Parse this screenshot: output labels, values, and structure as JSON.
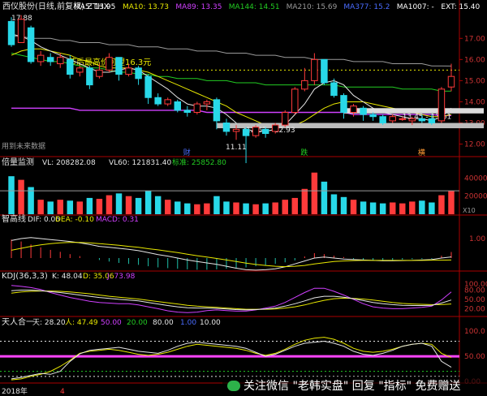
{
  "colors": {
    "up": "#ff3b3b",
    "down": "#28d8e8",
    "yellow": "#e8e800",
    "white": "#e6e6e6",
    "purple": "#d040ff",
    "green": "#22cc22",
    "grey": "#9a9a9a",
    "axis": "#aa0000",
    "magenta": "#ff44ff"
  },
  "main": {
    "title": "西仪股份(日线,前复权) ZTHX",
    "legend": [
      {
        "label": "MA5: 13.95",
        "color": "#ffffff"
      },
      {
        "label": "MA10: 13.73",
        "color": "#e8e800"
      },
      {
        "label": "MA89: 13.35",
        "color": "#d040ff"
      },
      {
        "label": "MA144: 14.51",
        "color": "#22cc22"
      },
      {
        "label": "MA210: 15.69",
        "color": "#9a9a9a"
      },
      {
        "label": "MA377: 15.2",
        "color": "#4a6cff"
      },
      {
        "label": "MA1007: -",
        "color": "#ffffff"
      },
      {
        "label": "EXT: 15.40",
        "color": "#ffffff"
      }
    ],
    "high_label": "17.88",
    "low_label": "11.11",
    "note": "用到未来数据",
    "annot_mid": "节后最高价可望",
    "annot_price": "16.3元",
    "box1": "13.45 - 13.61",
    "box2": "12.67 - 12.93",
    "tags": [
      "财",
      "跌",
      "横"
    ],
    "yaxis": [
      "17.00",
      "16.00",
      "15.00",
      "14.00",
      "13.00",
      "12.00"
    ]
  },
  "volume": {
    "title": "倍量监测",
    "vl": "VL: 208282.08",
    "vl60": "VL60: 121831.40",
    "std": "标准: 25852.80",
    "yaxis": [
      "40000",
      "20000"
    ],
    "unit": "X10"
  },
  "macd": {
    "title": "智高线",
    "dif": "DIF: 0.06",
    "dea": "DEA: -0.10",
    "macd": "MACD: 0.31",
    "yaxis": [
      "1.00"
    ]
  },
  "kdj": {
    "title": "KDJ(36,3,3)",
    "k": "K: 48.04",
    "d": "D: 35.06",
    "j": "J: 73.98",
    "yaxis": [
      "100.00",
      "80.00",
      "50.00",
      "20.00"
    ]
  },
  "tianren": {
    "title": "天人合一",
    "tian": "天: 28.20",
    "ren": "人: 47.49",
    "v50": "50.00",
    "v20": "20.00",
    "v80": "80.00",
    "v_blue": "1.00",
    "v10": "10.00",
    "yaxis": [
      "100.0",
      "50.00",
      "0.00"
    ]
  },
  "footer": {
    "year": "2018年",
    "mark": "4"
  },
  "watermark": "关注微信 \"老韩实盘\" 回复 \"指标\" 免费赠送",
  "chart_data": {
    "type": "candlestick",
    "candles": [
      {
        "o": 17.8,
        "c": 16.7,
        "h": 18.0,
        "l": 16.6
      },
      {
        "o": 16.8,
        "c": 17.9,
        "h": 18.1,
        "l": 16.8
      },
      {
        "o": 17.5,
        "c": 15.9,
        "h": 17.6,
        "l": 15.8
      },
      {
        "o": 15.9,
        "c": 16.2,
        "h": 16.4,
        "l": 15.7
      },
      {
        "o": 16.1,
        "c": 15.9,
        "h": 16.3,
        "l": 15.7
      },
      {
        "o": 15.8,
        "c": 16.1,
        "h": 16.3,
        "l": 15.6
      },
      {
        "o": 16.0,
        "c": 15.3,
        "h": 16.2,
        "l": 15.1
      },
      {
        "o": 15.4,
        "c": 15.6,
        "h": 15.7,
        "l": 15.2
      },
      {
        "o": 15.6,
        "c": 14.8,
        "h": 15.7,
        "l": 14.6
      },
      {
        "o": 15.2,
        "c": 15.5,
        "h": 15.8,
        "l": 15.1
      },
      {
        "o": 15.5,
        "c": 16.1,
        "h": 16.3,
        "l": 15.4
      },
      {
        "o": 16.1,
        "c": 15.3,
        "h": 16.1,
        "l": 15.0
      },
      {
        "o": 15.3,
        "c": 15.6,
        "h": 15.8,
        "l": 15.2
      },
      {
        "o": 15.6,
        "c": 15.1,
        "h": 15.7,
        "l": 14.8
      },
      {
        "o": 15.2,
        "c": 14.2,
        "h": 15.3,
        "l": 13.9
      },
      {
        "o": 14.2,
        "c": 13.9,
        "h": 14.4,
        "l": 13.8
      },
      {
        "o": 13.9,
        "c": 14.1,
        "h": 14.2,
        "l": 13.8
      },
      {
        "o": 14.0,
        "c": 13.6,
        "h": 14.1,
        "l": 13.5
      },
      {
        "o": 13.6,
        "c": 13.5,
        "h": 13.8,
        "l": 13.3
      },
      {
        "o": 13.5,
        "c": 13.9,
        "h": 14.0,
        "l": 13.4
      },
      {
        "o": 13.9,
        "c": 14.0,
        "h": 14.1,
        "l": 13.6
      },
      {
        "o": 14.1,
        "c": 13.1,
        "h": 14.2,
        "l": 12.7
      },
      {
        "o": 13.0,
        "c": 12.6,
        "h": 13.2,
        "l": 12.4
      },
      {
        "o": 12.6,
        "c": 12.7,
        "h": 12.9,
        "l": 12.2
      },
      {
        "o": 12.7,
        "c": 12.4,
        "h": 12.8,
        "l": 11.1
      },
      {
        "o": 12.4,
        "c": 12.8,
        "h": 12.9,
        "l": 12.3
      },
      {
        "o": 12.7,
        "c": 12.5,
        "h": 12.8,
        "l": 12.3
      },
      {
        "o": 12.6,
        "c": 12.9,
        "h": 13.0,
        "l": 12.5
      },
      {
        "o": 12.9,
        "c": 13.5,
        "h": 13.6,
        "l": 12.8
      },
      {
        "o": 13.5,
        "c": 14.6,
        "h": 14.7,
        "l": 13.4
      },
      {
        "o": 14.6,
        "c": 15.0,
        "h": 15.6,
        "l": 14.5
      },
      {
        "o": 15.0,
        "c": 16.0,
        "h": 16.3,
        "l": 14.8
      },
      {
        "o": 16.0,
        "c": 14.9,
        "h": 16.0,
        "l": 14.8
      },
      {
        "o": 14.9,
        "c": 14.3,
        "h": 15.1,
        "l": 14.2
      },
      {
        "o": 14.3,
        "c": 13.5,
        "h": 14.4,
        "l": 13.2
      },
      {
        "o": 13.5,
        "c": 13.8,
        "h": 13.9,
        "l": 13.3
      },
      {
        "o": 13.7,
        "c": 13.4,
        "h": 13.8,
        "l": 13.1
      },
      {
        "o": 13.4,
        "c": 13.3,
        "h": 13.5,
        "l": 13.1
      },
      {
        "o": 13.3,
        "c": 13.0,
        "h": 13.4,
        "l": 12.9
      },
      {
        "o": 13.1,
        "c": 13.3,
        "h": 13.4,
        "l": 13.0
      },
      {
        "o": 13.2,
        "c": 13.2,
        "h": 13.3,
        "l": 13.1
      },
      {
        "o": 13.1,
        "c": 13.2,
        "h": 13.3,
        "l": 12.9
      },
      {
        "o": 13.2,
        "c": 13.1,
        "h": 13.4,
        "l": 13.0
      },
      {
        "o": 13.2,
        "c": 13.0,
        "h": 13.4,
        "l": 12.9
      },
      {
        "o": 13.1,
        "c": 14.6,
        "h": 14.7,
        "l": 13.0
      },
      {
        "o": 14.7,
        "c": 15.2,
        "h": 15.8,
        "l": 14.5
      }
    ],
    "ma5": [
      17.2,
      17.1,
      16.9,
      16.6,
      16.4,
      16.2,
      16.0,
      15.8,
      15.6,
      15.4,
      15.4,
      15.5,
      15.6,
      15.5,
      15.2,
      14.9,
      14.6,
      14.2,
      13.9,
      13.8,
      13.8,
      13.7,
      13.4,
      13.0,
      12.7,
      12.6,
      12.6,
      12.7,
      12.9,
      13.4,
      13.9,
      14.6,
      14.9,
      15.0,
      14.8,
      14.3,
      14.0,
      13.7,
      13.5,
      13.4,
      13.3,
      13.2,
      13.2,
      13.1,
      13.3,
      13.7
    ],
    "ma10": [
      16.2,
      16.4,
      16.5,
      16.5,
      16.4,
      16.3,
      16.2,
      16.0,
      15.9,
      15.7,
      15.6,
      15.6,
      15.6,
      15.5,
      15.4,
      15.2,
      15.0,
      14.8,
      14.6,
      14.4,
      14.2,
      14.0,
      13.8,
      13.5,
      13.3,
      13.1,
      12.9,
      12.8,
      12.8,
      12.9,
      13.1,
      13.4,
      13.7,
      13.9,
      14.0,
      14.0,
      14.0,
      13.9,
      13.8,
      13.7,
      13.6,
      13.5,
      13.4,
      13.3,
      13.3,
      13.4
    ],
    "ma89": [
      13.7,
      13.7,
      13.7,
      13.7,
      13.7,
      13.7,
      13.7,
      13.6,
      13.6,
      13.6,
      13.6,
      13.6,
      13.6,
      13.6,
      13.6,
      13.6,
      13.6,
      13.6,
      13.6,
      13.6,
      13.5,
      13.5,
      13.5,
      13.5,
      13.5,
      13.5,
      13.5,
      13.5,
      13.5,
      13.5,
      13.5,
      13.5,
      13.5,
      13.5,
      13.5,
      13.4,
      13.4,
      13.4,
      13.4,
      13.4,
      13.4,
      13.4,
      13.4,
      13.4,
      13.35,
      13.35
    ],
    "ma144": [
      16.3,
      16.2,
      16.1,
      16.0,
      15.9,
      15.9,
      15.8,
      15.7,
      15.6,
      15.6,
      15.5,
      15.4,
      15.4,
      15.3,
      15.3,
      15.2,
      15.2,
      15.1,
      15.1,
      15.1,
      15.0,
      15.0,
      15.0,
      14.9,
      14.9,
      14.9,
      14.8,
      14.8,
      14.8,
      14.8,
      14.8,
      14.8,
      14.8,
      14.8,
      14.7,
      14.7,
      14.7,
      14.7,
      14.7,
      14.7,
      14.6,
      14.6,
      14.6,
      14.6,
      14.5,
      14.51
    ],
    "ma210": [
      17.1,
      17.1,
      17.0,
      17.0,
      17.0,
      16.9,
      16.9,
      16.8,
      16.8,
      16.8,
      16.7,
      16.7,
      16.7,
      16.6,
      16.6,
      16.6,
      16.5,
      16.5,
      16.5,
      16.4,
      16.4,
      16.4,
      16.3,
      16.3,
      16.3,
      16.2,
      16.2,
      16.2,
      16.1,
      16.1,
      16.1,
      16.0,
      16.0,
      16.0,
      16.0,
      15.9,
      15.9,
      15.9,
      15.9,
      15.8,
      15.8,
      15.8,
      15.8,
      15.7,
      15.7,
      15.69
    ],
    "volume": [
      42000,
      38000,
      30000,
      16000,
      14000,
      16000,
      15000,
      14000,
      18000,
      17000,
      21000,
      23000,
      20000,
      18000,
      26000,
      20000,
      16000,
      14000,
      12000,
      11000,
      12000,
      20000,
      14000,
      13000,
      12000,
      11000,
      12000,
      13000,
      16000,
      18000,
      28000,
      46000,
      36000,
      22000,
      19000,
      16000,
      14000,
      13000,
      12000,
      13000,
      12000,
      14000,
      15000,
      13000,
      21000,
      26000
    ],
    "volume_std": 25852.8,
    "macd_hist": [
      0.95,
      0.85,
      0.7,
      0.55,
      0.42,
      0.32,
      0.2,
      0.1,
      0.0,
      -0.1,
      -0.18,
      -0.25,
      -0.3,
      -0.35,
      -0.42,
      -0.48,
      -0.52,
      -0.55,
      -0.58,
      -0.6,
      -0.6,
      -0.58,
      -0.55,
      -0.52,
      -0.48,
      -0.42,
      -0.36,
      -0.3,
      -0.22,
      -0.12,
      0.08,
      0.25,
      0.2,
      0.12,
      0.05,
      -0.05,
      -0.1,
      -0.12,
      -0.12,
      -0.1,
      -0.08,
      -0.06,
      -0.05,
      -0.04,
      0.12,
      0.31
    ],
    "dif": [
      0.9,
      1.0,
      1.05,
      1.0,
      0.95,
      0.9,
      0.85,
      0.78,
      0.7,
      0.6,
      0.55,
      0.5,
      0.45,
      0.38,
      0.28,
      0.18,
      0.1,
      0.0,
      -0.1,
      -0.18,
      -0.25,
      -0.32,
      -0.42,
      -0.52,
      -0.6,
      -0.62,
      -0.6,
      -0.55,
      -0.45,
      -0.3,
      -0.15,
      0.0,
      0.05,
      0.0,
      -0.05,
      -0.08,
      -0.1,
      -0.12,
      -0.14,
      -0.14,
      -0.13,
      -0.12,
      -0.1,
      -0.08,
      0.0,
      0.06
    ],
    "dea": [
      0.4,
      0.5,
      0.6,
      0.68,
      0.74,
      0.78,
      0.8,
      0.8,
      0.78,
      0.74,
      0.7,
      0.66,
      0.6,
      0.55,
      0.48,
      0.42,
      0.35,
      0.28,
      0.2,
      0.12,
      0.05,
      -0.02,
      -0.1,
      -0.18,
      -0.26,
      -0.33,
      -0.38,
      -0.42,
      -0.44,
      -0.42,
      -0.38,
      -0.3,
      -0.24,
      -0.18,
      -0.15,
      -0.13,
      -0.12,
      -0.12,
      -0.12,
      -0.12,
      -0.12,
      -0.12,
      -0.12,
      -0.11,
      -0.11,
      -0.1
    ],
    "kdj_k": [
      78,
      80,
      80,
      78,
      75,
      72,
      68,
      64,
      60,
      56,
      53,
      50,
      48,
      45,
      40,
      35,
      30,
      26,
      23,
      22,
      22,
      21,
      19,
      17,
      16,
      17,
      19,
      22,
      28,
      36,
      45,
      55,
      60,
      60,
      57,
      52,
      46,
      40,
      36,
      33,
      31,
      30,
      30,
      31,
      38,
      48.04
    ],
    "kdj_d": [
      70,
      74,
      76,
      77,
      77,
      76,
      74,
      71,
      68,
      64,
      60,
      57,
      54,
      51,
      47,
      43,
      39,
      35,
      31,
      28,
      26,
      24,
      22,
      20,
      18,
      18,
      18,
      19,
      22,
      26,
      32,
      40,
      47,
      52,
      54,
      53,
      51,
      48,
      44,
      40,
      37,
      35,
      34,
      33,
      33,
      35.06
    ],
    "kdj_j": [
      95,
      92,
      88,
      82,
      72,
      64,
      56,
      50,
      44,
      40,
      38,
      36,
      36,
      32,
      26,
      20,
      13,
      9,
      7,
      9,
      14,
      16,
      14,
      12,
      12,
      16,
      22,
      28,
      40,
      56,
      72,
      86,
      86,
      76,
      64,
      50,
      36,
      26,
      22,
      20,
      20,
      22,
      24,
      28,
      48,
      73.98
    ],
    "tian": [
      5,
      8,
      12,
      16,
      14,
      20,
      40,
      55,
      62,
      64,
      66,
      68,
      64,
      60,
      58,
      56,
      62,
      70,
      76,
      78,
      76,
      74,
      72,
      70,
      66,
      58,
      50,
      54,
      62,
      70,
      76,
      78,
      80,
      76,
      70,
      60,
      54,
      52,
      56,
      62,
      70,
      74,
      76,
      70,
      40,
      28.2
    ],
    "ren": [
      3,
      5,
      10,
      14,
      20,
      30,
      42,
      56,
      60,
      62,
      64,
      62,
      58,
      54,
      52,
      54,
      58,
      64,
      70,
      74,
      72,
      70,
      68,
      66,
      62,
      56,
      52,
      56,
      64,
      74,
      82,
      86,
      88,
      84,
      76,
      66,
      60,
      58,
      60,
      64,
      70,
      74,
      76,
      74,
      56,
      47.49
    ]
  }
}
